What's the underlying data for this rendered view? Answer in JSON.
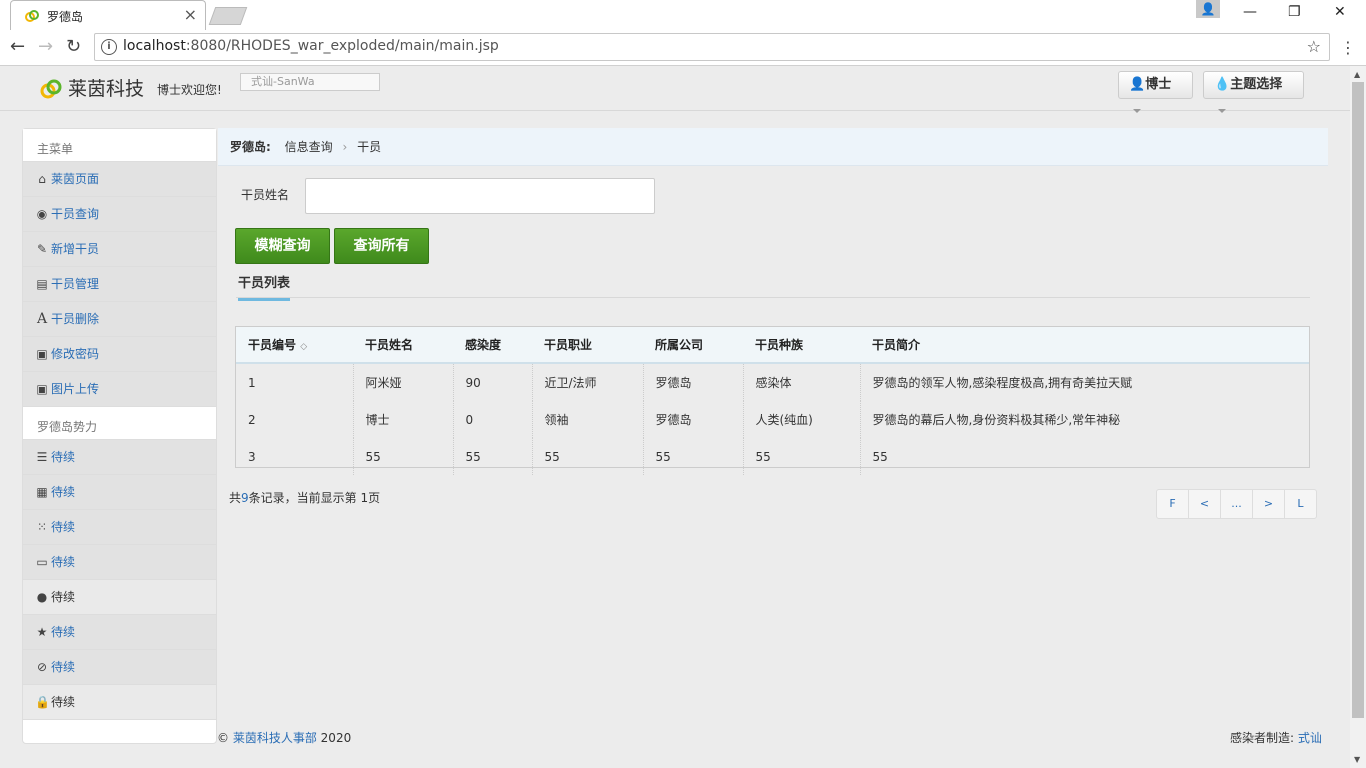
{
  "browser": {
    "tab_title": "罗德岛",
    "tab_close": "×",
    "url_host": "localhost",
    "url_rest": ":8080/RHODES_war_exploded/main/main.jsp",
    "info": "i",
    "star": "☆",
    "menu": "⋮",
    "back": "←",
    "forward": "→",
    "reload": "↻",
    "minimize": "—",
    "restore": "❐",
    "close": "✕"
  },
  "topbar": {
    "brand": "莱茵科技",
    "welcome": "博士欢迎您!",
    "user_field": "式讪-SanWa",
    "user_menu": "博士",
    "theme_menu": "主题选择"
  },
  "sidebar": {
    "main_heading": "主菜单",
    "main_items": [
      {
        "label": "莱茵页面",
        "icon": "home-icon"
      },
      {
        "label": "干员查询",
        "icon": "eye-icon"
      },
      {
        "label": "新增干员",
        "icon": "edit-icon"
      },
      {
        "label": "干员管理",
        "icon": "list-alt-icon"
      },
      {
        "label": "干员删除",
        "icon": "font-icon"
      },
      {
        "label": "修改密码",
        "icon": "picture-icon"
      },
      {
        "label": "图片上传",
        "icon": "picture-icon"
      }
    ],
    "power_heading": "罗德岛势力",
    "power_items": [
      {
        "label": "待续",
        "icon": "list-icon"
      },
      {
        "label": "待续",
        "icon": "calendar-icon"
      },
      {
        "label": "待续",
        "icon": "th-icon"
      },
      {
        "label": "待续",
        "icon": "folder-open-icon"
      },
      {
        "label": "待续",
        "icon": "globe-icon"
      },
      {
        "label": "待续",
        "icon": "star-icon"
      },
      {
        "label": "待续",
        "icon": "ban-icon"
      },
      {
        "label": "待续",
        "icon": "lock-icon"
      }
    ]
  },
  "breadcrumb": {
    "root": "罗德岛:",
    "section": "信息查询",
    "page": "干员"
  },
  "search": {
    "label": "干员姓名",
    "value": "",
    "fuzzy_button": "模糊查询",
    "all_button": "查询所有"
  },
  "list_tab": "干员列表",
  "table": {
    "headers": [
      "干员编号",
      "干员姓名",
      "感染度",
      "干员职业",
      "所属公司",
      "干员种族",
      "干员简介"
    ],
    "rows": [
      [
        "1",
        "阿米娅",
        "90",
        "近卫/法师",
        "罗德岛",
        "感染体",
        "罗德岛的领军人物,感染程度极高,拥有奇美拉天赋"
      ],
      [
        "2",
        "博士",
        "0",
        "领袖",
        "罗德岛",
        "人类(纯血)",
        "罗德岛的幕后人物,身份资料极其稀少,常年神秘"
      ],
      [
        "3",
        "55",
        "55",
        "55",
        "55",
        "55",
        "55"
      ]
    ]
  },
  "records": {
    "prefix": "共",
    "total": "9",
    "middle": "条记录，当前显示第 ",
    "page": "1",
    "suffix": "页"
  },
  "pager": [
    "F",
    "<",
    "...",
    ">",
    "L"
  ],
  "footer": {
    "copyright": "©",
    "company": "莱茵科技人事部",
    "year": "2020",
    "maker_label": "感染者制造:",
    "maker": "式讪"
  },
  "colors": {
    "link": "#2a6db5",
    "button_green": "#4a9a23",
    "breadcrumb_bg": "#edf4fa"
  }
}
